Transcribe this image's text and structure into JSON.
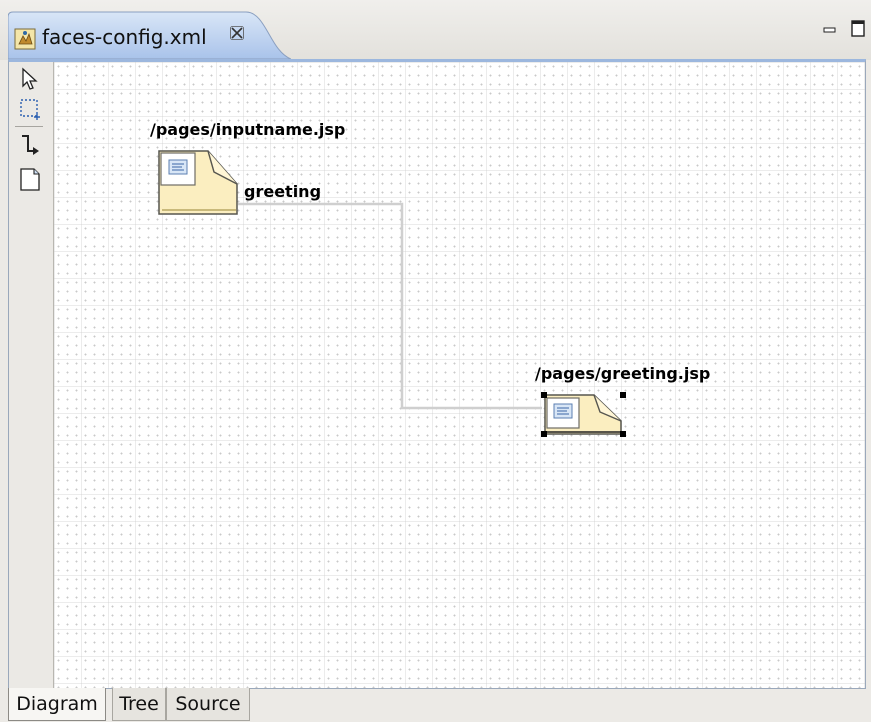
{
  "editor": {
    "tab_title": "faces-config.xml",
    "tab_icon": "faces-config-file-icon",
    "close_icon": "close-icon",
    "window_controls": [
      "minimize-icon",
      "maximize-icon"
    ]
  },
  "palette": {
    "tools": [
      {
        "name": "select-tool",
        "icon": "arrow-pointer-icon"
      },
      {
        "name": "marquee-tool",
        "icon": "dashed-rectangle-icon"
      },
      {
        "name": "connection-tool",
        "icon": "connection-arrow-icon"
      },
      {
        "name": "page-tool",
        "icon": "page-icon"
      }
    ]
  },
  "diagram": {
    "pages": [
      {
        "label": "/pages/inputname.jsp",
        "selected": false
      },
      {
        "label": "/pages/greeting.jsp",
        "selected": true
      }
    ],
    "transitions": [
      {
        "label": "greeting",
        "from": "/pages/inputname.jsp",
        "to": "/pages/greeting.jsp"
      }
    ]
  },
  "bottom_tabs": [
    {
      "label": "Diagram",
      "active": true
    },
    {
      "label": "Tree",
      "active": false
    },
    {
      "label": "Source",
      "active": false
    }
  ],
  "colors": {
    "tab_highlight": "#bfd3ef",
    "page_fill": "#fbeec0",
    "page_border": "#57564f",
    "connection": "#cfcfcf"
  }
}
